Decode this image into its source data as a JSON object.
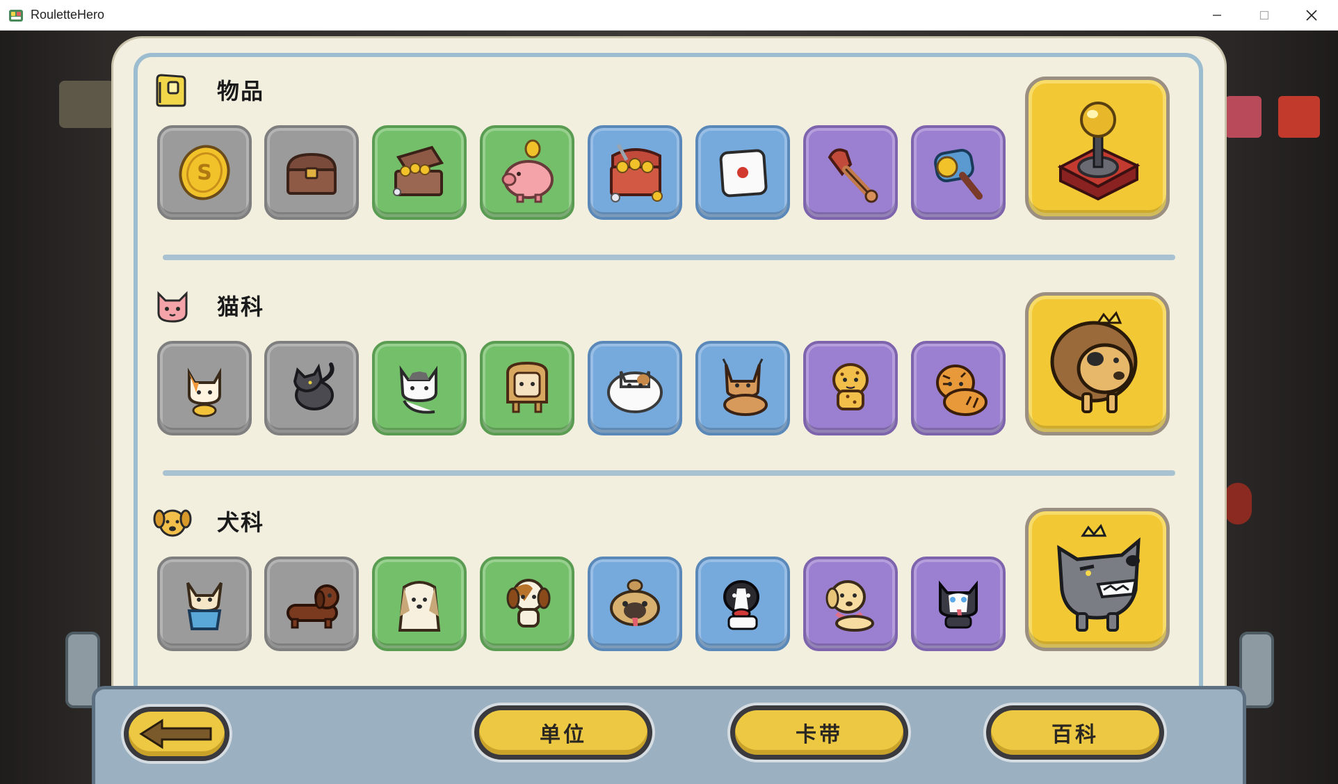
{
  "window": {
    "title": "RouletteHero",
    "icon": "roulette-hero-app-icon",
    "controls": [
      "minimize-icon",
      "maximize-icon",
      "close-icon"
    ]
  },
  "sections": [
    {
      "title": "物品",
      "icon": "item-bag-icon",
      "tiles": [
        {
          "icon": "gold-coin-icon",
          "rarity": "gray"
        },
        {
          "icon": "small-chest-icon",
          "rarity": "gray"
        },
        {
          "icon": "treasure-chest-gold-icon",
          "rarity": "green"
        },
        {
          "icon": "piggy-bank-icon",
          "rarity": "green"
        },
        {
          "icon": "treasure-hoard-icon",
          "rarity": "blue"
        },
        {
          "icon": "dice-icon",
          "rarity": "blue"
        },
        {
          "icon": "grabber-claw-icon",
          "rarity": "purple"
        },
        {
          "icon": "coin-hammer-icon",
          "rarity": "purple"
        }
      ],
      "boss": {
        "icon": "joystick-lever-icon"
      }
    },
    {
      "title": "猫科",
      "icon": "cat-face-icon",
      "tiles": [
        {
          "icon": "calico-kitten-icon",
          "rarity": "gray"
        },
        {
          "icon": "black-cat-icon",
          "rarity": "gray"
        },
        {
          "icon": "tuxedo-cat-icon",
          "rarity": "green"
        },
        {
          "icon": "bread-cat-icon",
          "rarity": "green"
        },
        {
          "icon": "fluffy-white-cat-icon",
          "rarity": "blue"
        },
        {
          "icon": "caracal-icon",
          "rarity": "blue"
        },
        {
          "icon": "cheetah-icon",
          "rarity": "purple"
        },
        {
          "icon": "tiger-icon",
          "rarity": "purple"
        }
      ],
      "boss": {
        "icon": "lion-king-icon"
      }
    },
    {
      "title": "犬科",
      "icon": "dog-face-icon",
      "tiles": [
        {
          "icon": "chihuahua-in-cup-icon",
          "rarity": "gray"
        },
        {
          "icon": "dachshund-icon",
          "rarity": "gray"
        },
        {
          "icon": "shih-tzu-icon",
          "rarity": "green"
        },
        {
          "icon": "beagle-icon",
          "rarity": "green"
        },
        {
          "icon": "pug-icon",
          "rarity": "blue"
        },
        {
          "icon": "border-collie-icon",
          "rarity": "blue"
        },
        {
          "icon": "labrador-icon",
          "rarity": "purple"
        },
        {
          "icon": "husky-icon",
          "rarity": "purple"
        }
      ],
      "boss": {
        "icon": "wolf-king-icon"
      }
    }
  ],
  "bottom_bar": {
    "back_icon": "back-arrow-icon",
    "units_label": "单位",
    "cassette_label": "卡带",
    "wiki_label": "百科"
  },
  "colors": {
    "gray": "#9b9b9b",
    "green": "#74c06a",
    "blue": "#76a9dc",
    "purple": "#9b7fd0",
    "boss_gold": "#f2c935",
    "panel_bg": "#f2efdf",
    "button_yellow": "#ecc843"
  }
}
